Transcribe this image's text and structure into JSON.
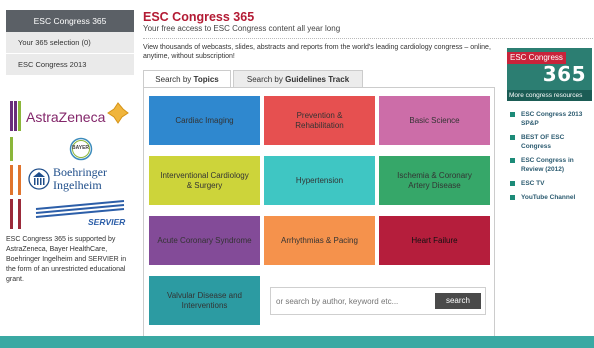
{
  "sidebar": {
    "header": "ESC Congress 365",
    "items": [
      "Your 365 selection (0)",
      "ESC Congress 2013"
    ],
    "sponsor_logos": [
      "AstraZeneca",
      "BAYER",
      "Boehringer Ingelheim",
      "SERVIER"
    ],
    "sponsor_note": "ESC Congress 365 is supported by AstraZeneca, Bayer HealthCare, Boehringer Ingelheim and SERVIER in the form of an unrestricted educational grant."
  },
  "main": {
    "title": "ESC Congress 365",
    "subtitle": "Your free access to ESC Congress content all year long",
    "intro": "View thousands of webcasts, slides, abstracts and reports from the world's leading cardiology congress – online, anytime, without subscription!",
    "tabs": [
      {
        "prefix": "Search by ",
        "bold": "Topics",
        "active": true
      },
      {
        "prefix": "Search by ",
        "bold": "Guidelines Track",
        "active": false
      }
    ],
    "topics": [
      {
        "label": "Cardiac Imaging",
        "color": "#2f88cf"
      },
      {
        "label": "Prevention & Rehabilitation",
        "color": "#e65050"
      },
      {
        "label": "Basic Science",
        "color": "#cc6da8"
      },
      {
        "label": "Interventional Cardiology & Surgery",
        "color": "#cdd43a"
      },
      {
        "label": "Hypertension",
        "color": "#3fc6c3"
      },
      {
        "label": "Ischemia & Coronary Artery Disease",
        "color": "#36a769"
      },
      {
        "label": "Acute Coronary Syndrome",
        "color": "#834b98"
      },
      {
        "label": "Arrhythmias & Pacing",
        "color": "#f5924c"
      },
      {
        "label": "Heart Failure",
        "color": "#b51e3c"
      },
      {
        "label": "Valvular Disease and Interventions",
        "color": "#2c9ba2"
      }
    ],
    "search": {
      "placeholder": "or search by author, keyword etc...",
      "button": "search"
    }
  },
  "right": {
    "logo_text": "ESC Congress",
    "logo_number": "365",
    "more_label": "More congress resources",
    "links": [
      "ESC Congress 2013 SP&P",
      "BEST OF ESC Congress",
      "ESC Congress in Review (2012)",
      "ESC TV",
      "YouTube Channel"
    ]
  }
}
